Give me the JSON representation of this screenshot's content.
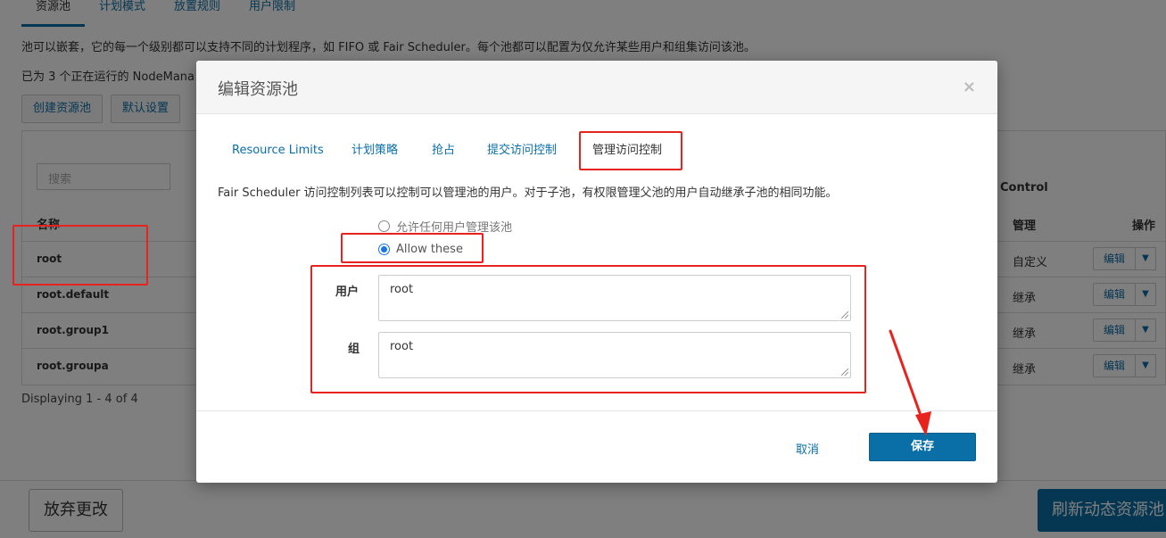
{
  "background": {
    "tabs": [
      {
        "label": "资源池",
        "active": true
      },
      {
        "label": "计划模式",
        "active": false
      },
      {
        "label": "放置规则",
        "active": false
      },
      {
        "label": "用户限制",
        "active": false
      }
    ],
    "description": "池可以嵌套，它的每一个级别都可以支持不同的计划程序，如 FIFO 或 Fair Scheduler。每个池都可以配置为仅允许某些用户和组集访问该池。",
    "running_text": "已为 3 个正在运行的 NodeMana",
    "buttons": {
      "create": "创建资源池",
      "defaults": "默认设置"
    },
    "table": {
      "search_placeholder": "搜索",
      "col_name": "名称",
      "col_control": "Control",
      "col_manage": "管理",
      "col_ops": "操作",
      "edit_label": "编辑",
      "rows": [
        {
          "name": "root",
          "manage": "自定义"
        },
        {
          "name": "root.default",
          "manage": "继承"
        },
        {
          "name": "root.group1",
          "manage": "继承"
        },
        {
          "name": "root.groupa",
          "manage": "继承"
        }
      ]
    },
    "displaying": "Displaying 1 - 4 of 4",
    "footer": {
      "discard": "放弃更改",
      "refresh": "刷新动态资源池"
    }
  },
  "modal": {
    "title": "编辑资源池",
    "close_glyph": "×",
    "tabs": [
      {
        "label": "Resource Limits",
        "active": false
      },
      {
        "label": "计划策略",
        "active": false
      },
      {
        "label": "抢占",
        "active": false
      },
      {
        "label": "提交访问控制",
        "active": false
      },
      {
        "label": "管理访问控制",
        "active": true
      }
    ],
    "description": "Fair Scheduler 访问控制列表可以控制可以管理池的用户。对于子池，有权限管理父池的用户自动继承子池的相同功能。",
    "radio_any": "允许任何用户管理该池",
    "radio_allow": "Allow these",
    "selected_radio": "allow",
    "users_label": "用户",
    "users_value": "root",
    "groups_label": "组",
    "groups_value": "root",
    "cancel": "取消",
    "save": "保存"
  },
  "colors": {
    "accent": "#0a6fa6",
    "annotation": "#e8231d",
    "radio": "#1a73e8"
  }
}
